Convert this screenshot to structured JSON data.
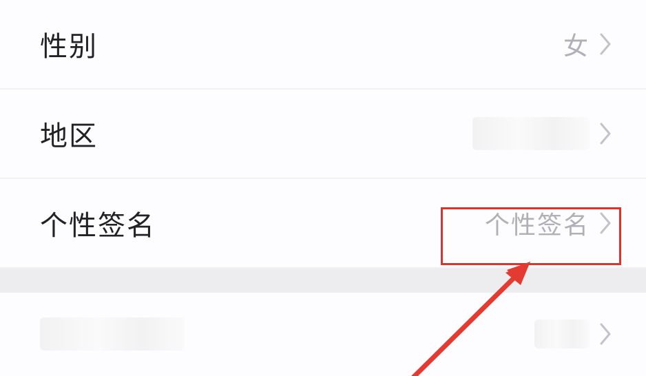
{
  "rows": [
    {
      "id": "gender",
      "label": "性别",
      "value": "女"
    },
    {
      "id": "region",
      "label": "地区",
      "value": ""
    },
    {
      "id": "signature",
      "label": "个性签名",
      "value": "个性签名"
    },
    {
      "id": "unknown",
      "label": "",
      "value": ""
    }
  ],
  "annotation": {
    "highlight_color": "#d9352d",
    "arrow_color": "#e33b32"
  }
}
